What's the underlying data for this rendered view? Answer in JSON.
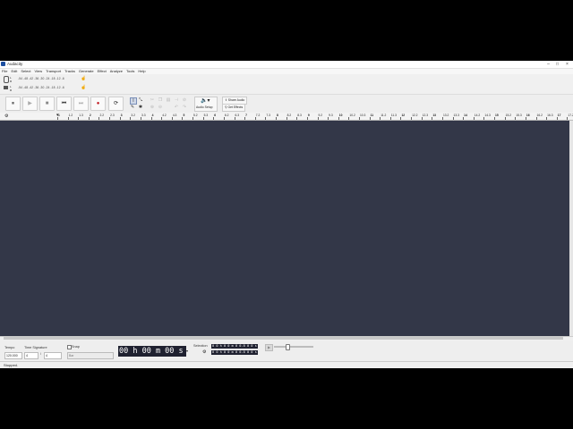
{
  "window": {
    "title": "Audacity",
    "controls": [
      "–",
      "□",
      "×"
    ]
  },
  "menu": [
    "File",
    "Edit",
    "Select",
    "View",
    "Transport",
    "Tracks",
    "Generate",
    "Effect",
    "Analyze",
    "Tools",
    "Help"
  ],
  "meters": {
    "record_scale": "-54 -48 -42 -36 -30 -24 -18 -12 -6",
    "playback_scale": "-54 -48 -42 -36 -30 -24 -18 -12 -6"
  },
  "transport": {
    "pause": "⏸",
    "play": "▶",
    "stop": "■",
    "skip_start": "⏮",
    "skip_end": "⏭",
    "record": "●",
    "loop": "⟳"
  },
  "tools": {
    "selection": "I",
    "envelope": "⤡",
    "draw": "✎",
    "multi": "✱"
  },
  "buttons": {
    "audio_setup": "Audio Setup",
    "share_audio": "Share Audio",
    "get_effects": "Get Effects"
  },
  "ruler": {
    "ticks": [
      "1",
      "1.2",
      "1.3",
      "2",
      "2.2",
      "2.3",
      "3",
      "3.2",
      "3.3",
      "4",
      "4.2",
      "4.3",
      "5",
      "5.2",
      "5.3",
      "6",
      "6.2",
      "6.3",
      "7",
      "7.2",
      "7.3",
      "8",
      "8.2",
      "8.3",
      "9",
      "9.2",
      "9.3",
      "10",
      "10.2",
      "10.3",
      "11",
      "11.2",
      "11.3",
      "12",
      "12.2",
      "12.3",
      "13",
      "13.2",
      "13.3",
      "14",
      "14.2",
      "14.3",
      "15",
      "15.2",
      "15.3",
      "16",
      "16.2",
      "16.3",
      "17",
      "17.2"
    ]
  },
  "bottom": {
    "tempo_label": "Tempo",
    "tempo_value": "120.000",
    "time_sig_label": "Time Signature",
    "time_sig_num": "4",
    "time_sig_den": "4",
    "snap_label": "Snap",
    "snap_value": "Bar",
    "time_display": "00 h 00 m 00 s",
    "selection_label": "Selection",
    "sel_start": "0 0 h 0 0 m 0 0.0 0 0 s",
    "sel_end": "0 0 h 0 0 m 0 0.0 0 0 s"
  },
  "status": {
    "text": "Stopped."
  }
}
